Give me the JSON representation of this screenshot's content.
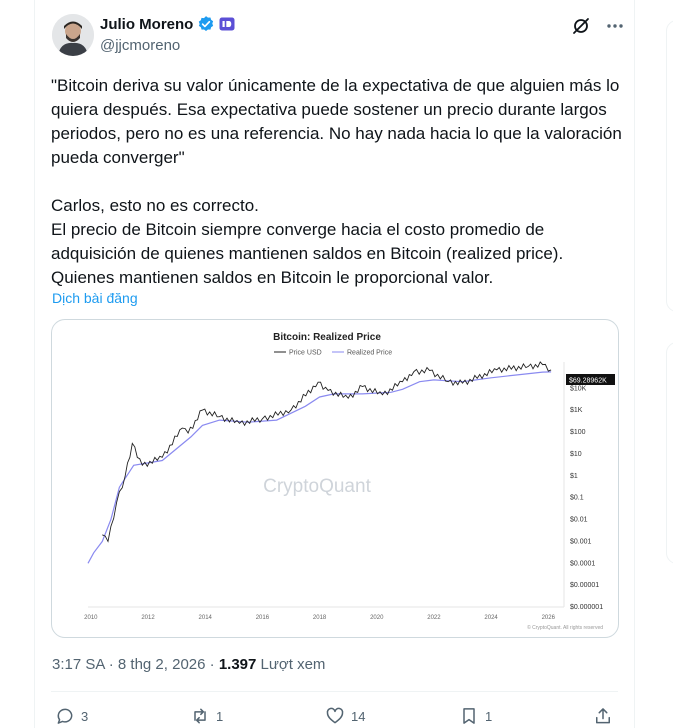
{
  "tweet": {
    "author_name": "Julio Moreno",
    "author_handle": "@jjcmoreno",
    "body": "\"Bitcoin deriva su valor únicamente de la expectativa de que alguien más lo quiera después. Esa expectativa puede sostener un precio durante largos periodos, pero no es una referencia. No hay nada hacia lo que la valoración pueda converger\"\n\nCarlos, esto no es correcto.\nEl precio de Bitcoin siempre converge hacia el costo promedio de adquisición de quienes mantienen saldos en Bitcoin (realized price).\nQuienes mantienen saldos en Bitcoin le proporcional valor.",
    "translate_label": "Dịch bài đăng",
    "time": "3:17 SA",
    "separator": " · ",
    "date": "8 thg 2, 2026",
    "views_count": "1.397",
    "views_label": "Lượt xem"
  },
  "actions": {
    "replies": "3",
    "reposts": "1",
    "likes": "14",
    "bookmarks": "1"
  },
  "icons": [
    "verified-badge-icon",
    "affiliate-badge-icon",
    "grok-icon",
    "more-icon",
    "reply-icon",
    "repost-icon",
    "like-icon",
    "bookmark-icon",
    "share-icon"
  ],
  "colors": {
    "accent": "#1d9bf0",
    "price_line": "#222222",
    "realized_line": "#8a8af0",
    "price_tag_bg": "#111111"
  },
  "chart_data": {
    "type": "line",
    "title": "Bitcoin: Realized Price",
    "legend": [
      "Price USD",
      "Realized Price"
    ],
    "legend_position": "top",
    "watermark": "CryptoQuant",
    "copyright": "© CryptoQuant. All rights reserved",
    "x_ticks": [
      "2010",
      "2012",
      "2014",
      "2016",
      "2018",
      "2020",
      "2022",
      "2024",
      "2026"
    ],
    "y_ticks": [
      "$10K",
      "$1K",
      "$100",
      "$10",
      "$1",
      "$0.1",
      "$0.01",
      "$0.001",
      "$0.0001",
      "$0.00001",
      "$0.000001"
    ],
    "y_scale": "log",
    "current_price_label": "$69.28962K",
    "series": [
      {
        "name": "Price USD",
        "x": [
          2010.4,
          2010.6,
          2010.9,
          2011.2,
          2011.45,
          2011.8,
          2012.5,
          2013.2,
          2013.4,
          2013.9,
          2014.5,
          2015.2,
          2016.0,
          2017.0,
          2017.95,
          2018.3,
          2019.0,
          2019.5,
          2020.2,
          2020.9,
          2021.3,
          2021.85,
          2022.5,
          2023.0,
          2024.2,
          2025.3,
          2025.8,
          2026.1
        ],
        "y": [
          0.002,
          0.001,
          0.06,
          1,
          30,
          3,
          7,
          150,
          90,
          1000,
          500,
          250,
          400,
          1000,
          19000,
          8000,
          3500,
          12000,
          5000,
          20000,
          58000,
          65000,
          20000,
          17000,
          70000,
          100000,
          120000,
          69289
        ]
      },
      {
        "name": "Realized Price",
        "x": [
          2009.9,
          2010.1,
          2010.4,
          2010.7,
          2011.0,
          2011.5,
          2012.5,
          2013.5,
          2013.9,
          2014.5,
          2015.5,
          2016.5,
          2017.5,
          2018.0,
          2018.5,
          2019.5,
          2020.5,
          2020.9,
          2021.5,
          2022.0,
          2022.5,
          2023.0,
          2024.0,
          2025.0,
          2025.8,
          2026.1
        ],
        "y": [
          0.0001,
          0.0003,
          0.001,
          0.01,
          0.3,
          3,
          5,
          60,
          200,
          350,
          280,
          350,
          1500,
          4000,
          5500,
          5500,
          6500,
          9000,
          20000,
          24000,
          22000,
          20000,
          30000,
          42000,
          55000,
          56000
        ]
      }
    ]
  }
}
